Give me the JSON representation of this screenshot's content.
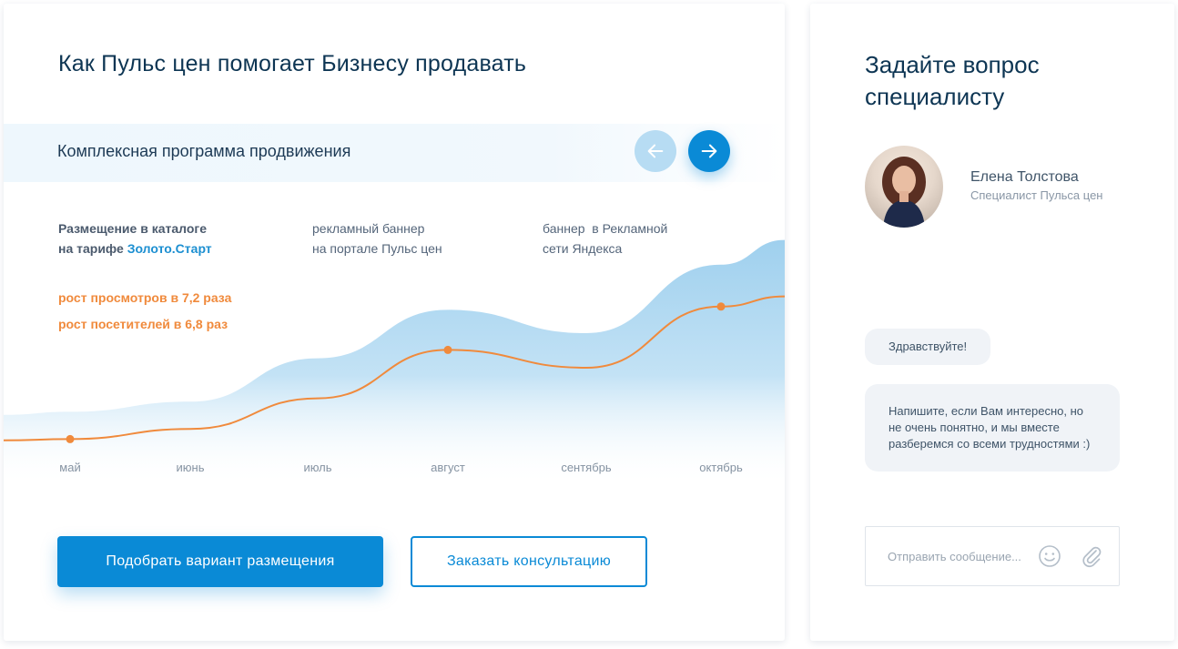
{
  "left_card": {
    "title": "Как Пульс цен помогает Бизнесу продавать",
    "program_label": "Комплексная программа продвижения",
    "columns": [
      {
        "line1": "Размещение в каталоге",
        "line2_prefix": "на тарифе ",
        "line2_highlight": "Золото.Старт"
      },
      {
        "line1": "рекламный баннер",
        "line2": "на портале Пульс цен"
      },
      {
        "line1": "баннер  в Рекламной",
        "line2": "сети Яндекса"
      }
    ],
    "growth": [
      "рост просмотров в 7,2 раза",
      "рост посетителей в 6,8 раз"
    ],
    "primary_button": "Подобрать вариант размещения",
    "secondary_button": "Заказать консультацию"
  },
  "chart_data": {
    "type": "area",
    "categories": [
      "май",
      "июнь",
      "июль",
      "август",
      "сентябрь",
      "октябрь"
    ],
    "series": [
      {
        "values": [
          1,
          1.4,
          2.6,
          4.5,
          3.8,
          6.2
        ]
      }
    ],
    "highlighted": [
      "май",
      "август",
      "октябрь"
    ],
    "colors": {
      "area": "#a6d4ef",
      "line": "#f08a3c"
    }
  },
  "right_card": {
    "title": "Задайте вопрос специалисту",
    "specialist": {
      "name": "Елена Толстова",
      "role": "Специалист Пульса цен"
    },
    "messages": [
      "Здравствуйте!",
      "Напишите, если Вам интересно, но не очень понятно, и мы вместе разберемся со всеми трудностями :)"
    ],
    "input_placeholder": "Отправить сообщение..."
  },
  "colors": {
    "accent": "#0a8ad6",
    "accent_light": "#b7dcf3",
    "orange": "#f08a3c",
    "heading": "#0d3553"
  }
}
